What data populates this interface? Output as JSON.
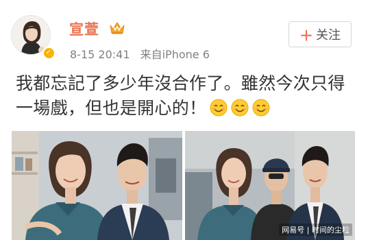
{
  "post": {
    "username": "宣萱",
    "date": "8-15",
    "time": "20:41",
    "source": "来自iPhone 6",
    "text": "我都忘記了多少年沒合作了。雖然今次只得一場戲，但也是開心的！",
    "emoji_count": 3,
    "emoji_name": "smile-emoji"
  },
  "follow": {
    "label": "关注"
  },
  "icons": {
    "verified": "verified-badge-icon",
    "vip": "vip-crown-icon",
    "plus": "plus-icon"
  },
  "watermark": {
    "text": "网易号 | 时间的尘粒"
  },
  "colors": {
    "username": "#eb7350",
    "meta": "#808080",
    "accent": "#eb7350",
    "badge": "#f7b400"
  }
}
